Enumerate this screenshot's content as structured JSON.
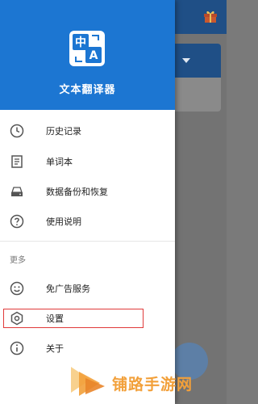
{
  "app": {
    "name": "文本翻译器",
    "logo_icon": "translate-zh-a-icon"
  },
  "menu": [
    {
      "label": "历史记录",
      "icon": "clock-icon"
    },
    {
      "label": "单词本",
      "icon": "notebook-icon"
    },
    {
      "label": "数据备份和恢复",
      "icon": "storage-icon"
    },
    {
      "label": "使用说明",
      "icon": "help-icon"
    }
  ],
  "more_section": {
    "title": "更多",
    "items": [
      {
        "label": "免广告服务",
        "icon": "smiley-icon"
      },
      {
        "label": "设置",
        "icon": "gear-icon",
        "highlighted": true
      },
      {
        "label": "关于",
        "icon": "info-icon"
      }
    ]
  },
  "watermark": {
    "text": "铺路手游网"
  },
  "colors": {
    "header": "#1c76d2",
    "highlight": "#e03a3a",
    "watermark": "#f2a03a"
  }
}
